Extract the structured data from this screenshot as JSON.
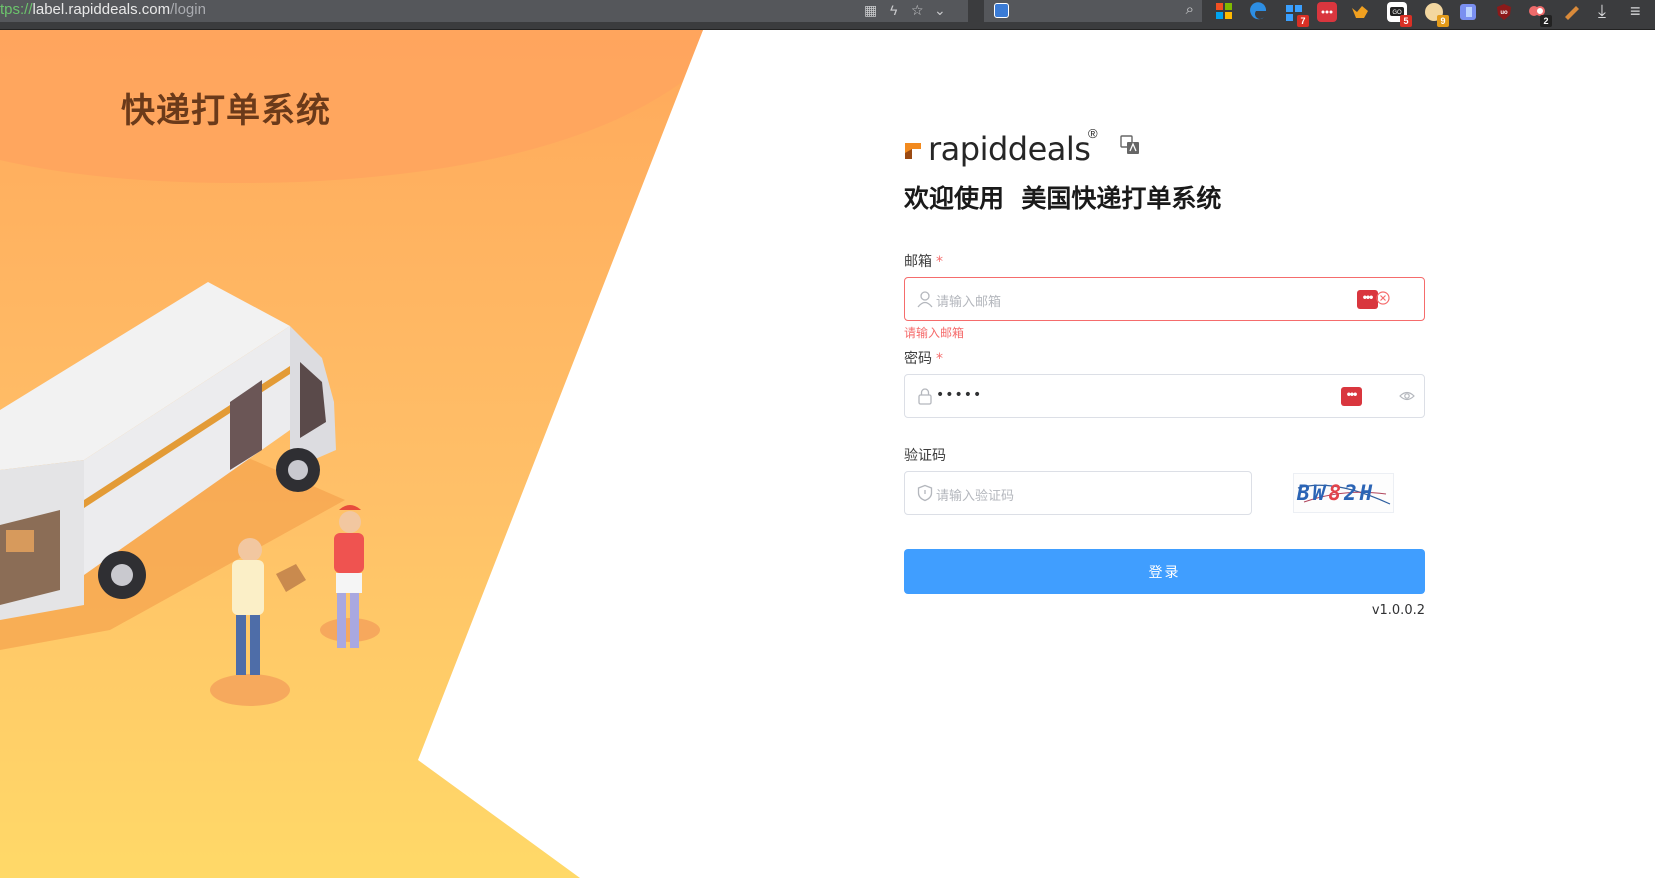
{
  "browser": {
    "url_scheme": "tps://",
    "url_host": "label.rapiddeals.com",
    "url_path": "/login",
    "extension_badges": [
      "7",
      "5",
      "9",
      "2"
    ]
  },
  "left": {
    "system_title": "快递打单系统"
  },
  "brand": {
    "name": "rapiddeals",
    "registered": "®",
    "accent": "#f28a1e"
  },
  "welcome": "欢迎使用  美国快递打单系统",
  "form": {
    "email": {
      "label": "邮箱",
      "required_mark": "*",
      "placeholder": "请输入邮箱",
      "error": "请输入邮箱"
    },
    "password": {
      "label": "密码",
      "required_mark": "*",
      "value": "•••••"
    },
    "captcha": {
      "label": "验证码",
      "placeholder": "请输入验证码",
      "chars": [
        "B",
        "W",
        "8",
        "2",
        "H"
      ]
    },
    "manager_badge": "•••",
    "submit_label": "登录",
    "version": "v1.0.0.2"
  },
  "colors": {
    "primary": "#409eff",
    "error": "#f56c6c",
    "panel_orange": "#ffb15a",
    "panel_yellow": "#ffd667"
  }
}
